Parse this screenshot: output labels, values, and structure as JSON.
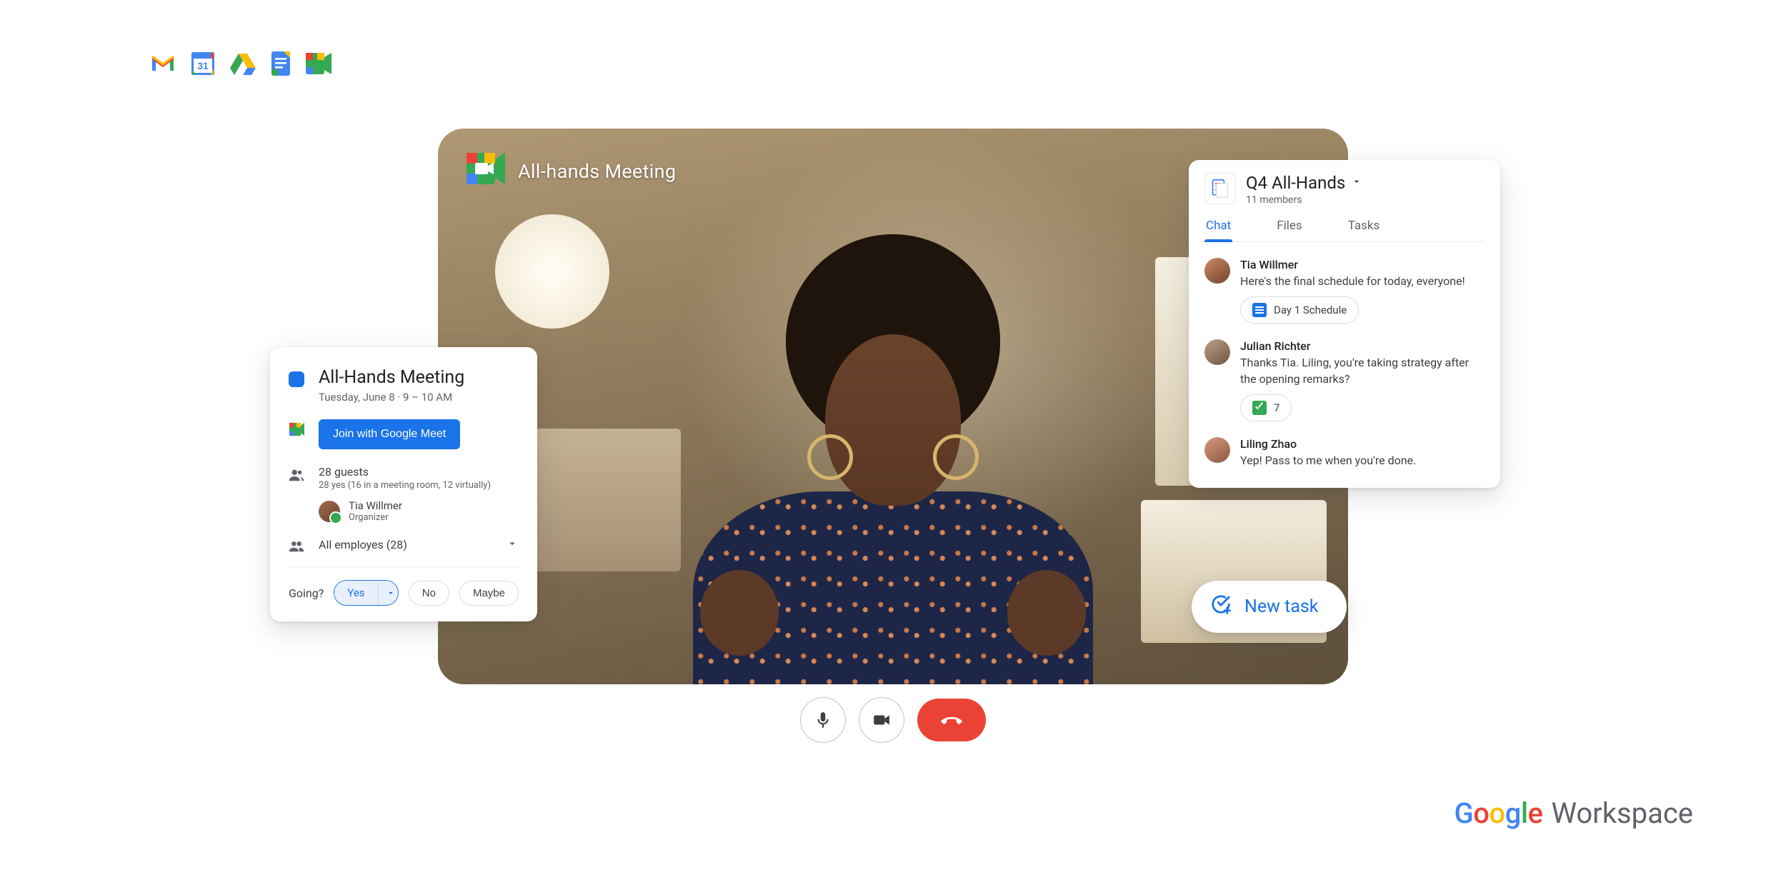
{
  "meet": {
    "overlay_title": "All-hands Meeting"
  },
  "event": {
    "title": "All-Hands Meeting",
    "datetime": "Tuesday, June 8  ·  9 – 10 AM",
    "join_label": "Join with Google Meet",
    "guests_count": "28 guests",
    "guests_detail": "28 yes (16 in a meeting room, 12 virtually)",
    "organizer_name": "Tia Willmer",
    "organizer_role": "Organizer",
    "group_label": "All employes (28)",
    "going_label": "Going?",
    "rsvp": {
      "yes": "Yes",
      "no": "No",
      "maybe": "Maybe"
    }
  },
  "space": {
    "title": "Q4 All-Hands",
    "members": "11 members",
    "tabs": {
      "chat": "Chat",
      "files": "Files",
      "tasks": "Tasks"
    },
    "messages": [
      {
        "name": "Tia Willmer",
        "text": "Here's the final schedule for today, everyone!",
        "chip": {
          "kind": "doc",
          "label": "Day 1 Schedule"
        }
      },
      {
        "name": "Julian Richter",
        "text": "Thanks Tia. Liling, you're taking strategy after the opening remarks?",
        "chip": {
          "kind": "reaction",
          "label": "7"
        }
      },
      {
        "name": "Liling Zhao",
        "text": "Yep! Pass to me when you're done."
      }
    ]
  },
  "new_task_label": "New task",
  "workspace_brand": {
    "google": "Google",
    "workspace": "Workspace"
  }
}
